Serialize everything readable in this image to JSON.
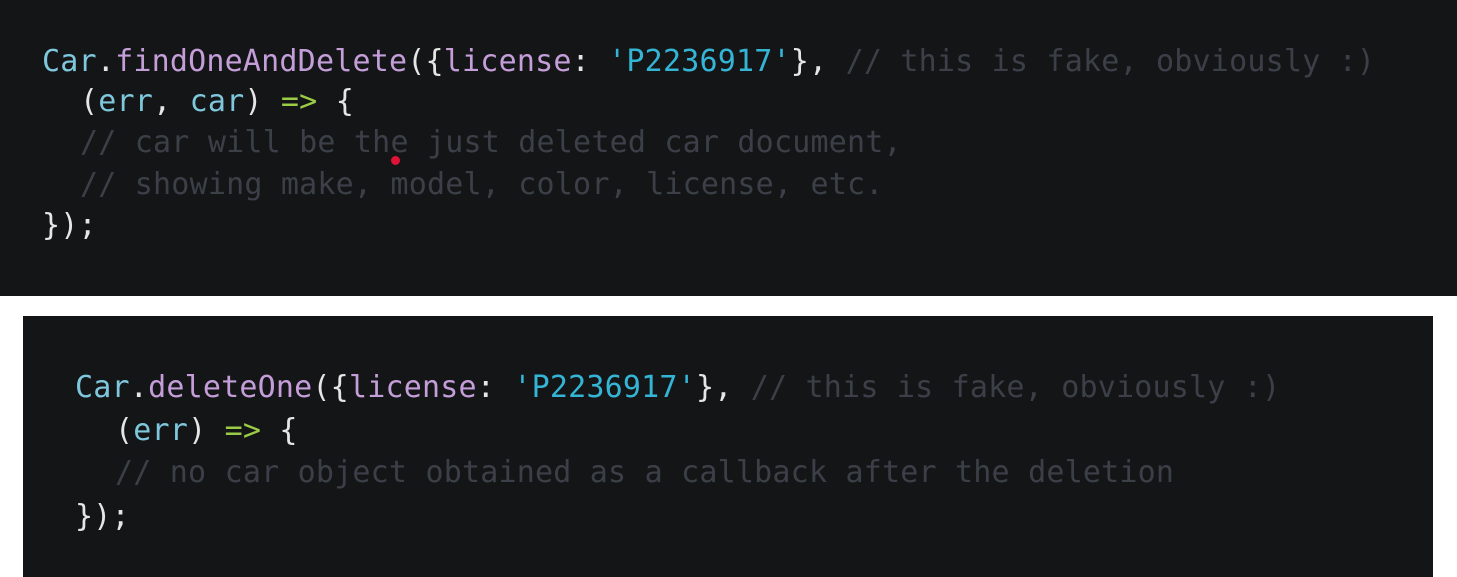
{
  "block1": {
    "line1": {
      "obj": "Car",
      "dot": ".",
      "method": "findOneAndDelete",
      "open": "({",
      "key": "license",
      "colon": ": ",
      "value": "'P2236917'",
      "close": "},",
      "comment": " // this is fake, obviously :)"
    },
    "line2": {
      "open_paren": "(",
      "arg1": "err",
      "comma": ", ",
      "arg2": "car",
      "close_paren": ")",
      "arrow": " => ",
      "brace": "{"
    },
    "line3": {
      "comment": "// car will be the just deleted car document,"
    },
    "line4": {
      "comment": "// showing make, model, color, license, etc."
    },
    "line5": {
      "close": "});"
    }
  },
  "block2": {
    "line1": {
      "obj": "Car",
      "dot": ".",
      "method": "deleteOne",
      "open": "({",
      "key": "license",
      "colon": ": ",
      "value": "'P2236917'",
      "close": "},",
      "comment": " // this is fake, obviously :)"
    },
    "line2": {
      "open_paren": "(",
      "arg1": "err",
      "close_paren": ")",
      "arrow": " => ",
      "brace": "{"
    },
    "line3": {
      "comment": "// no car object obtained as a callback after the deletion"
    },
    "line4": {
      "close": "});"
    }
  },
  "colors": {
    "background": "#141517",
    "identifier": "#7ec7dc",
    "method": "#c49ed9",
    "string": "#34b5d5",
    "arrow": "#9ccc45",
    "comment": "#3b4048",
    "punctuation": "#e6e6e6",
    "cursor": "#e01236"
  }
}
